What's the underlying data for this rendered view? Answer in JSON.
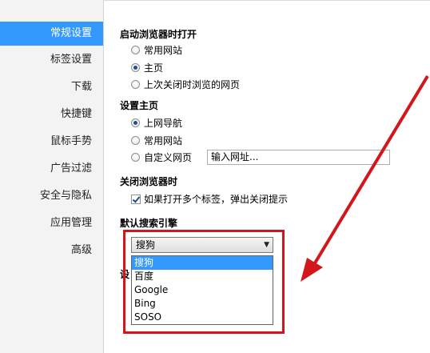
{
  "sidebar": {
    "items": [
      {
        "label": "常规设置",
        "active": true
      },
      {
        "label": "标签设置"
      },
      {
        "label": "下载"
      },
      {
        "label": "快捷键"
      },
      {
        "label": "鼠标手势"
      },
      {
        "label": "广告过滤"
      },
      {
        "label": "安全与隐私"
      },
      {
        "label": "应用管理"
      },
      {
        "label": "高级"
      }
    ]
  },
  "startup": {
    "title": "启动浏览器时打开",
    "options": [
      "常用网站",
      "主页",
      "上次关闭时浏览的网页"
    ],
    "selected": "主页"
  },
  "homepage": {
    "title": "设置主页",
    "options": [
      "上网导航",
      "常用网站",
      "自定义网页"
    ],
    "selected": "上网导航",
    "url_value": "输入网址..."
  },
  "close": {
    "title": "关闭浏览器时",
    "checkbox_label": "如果打开多个标签，弹出关闭提示",
    "checked": true
  },
  "search": {
    "title": "默认搜索引擎",
    "selected": "搜狗",
    "options": [
      "搜狗",
      "百度",
      "Google",
      "Bing",
      "SOSO"
    ],
    "obscured_heading_fragment": "设"
  },
  "colors": {
    "accent": "#3399ff",
    "annotation": "#d3161b"
  }
}
